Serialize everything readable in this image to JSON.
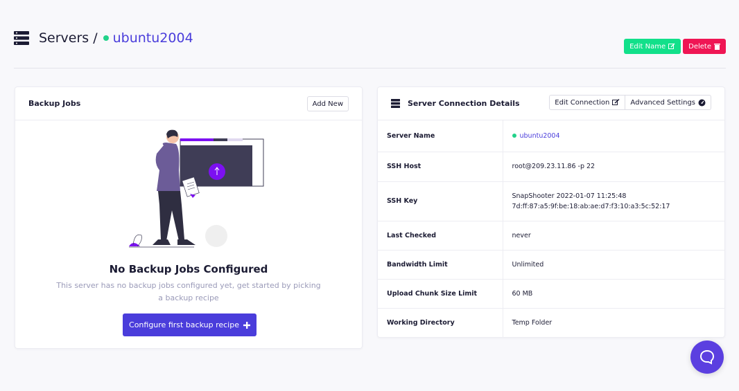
{
  "header": {
    "title": "Servers",
    "separator": "/",
    "server_name": "ubuntu2004",
    "status_color": "#22d28a"
  },
  "actions": {
    "edit_name": "Edit Name",
    "delete": "Delete"
  },
  "backup_jobs": {
    "title": "Backup Jobs",
    "add_new": "Add New",
    "empty_title": "No Backup Jobs Configured",
    "empty_desc": "This server has no backup jobs configured yet, get started by picking a backup recipe",
    "cta": "Configure first backup recipe"
  },
  "connection": {
    "title": "Server Connection Details",
    "edit_connection": "Edit Connection",
    "advanced_settings": "Advanced Settings",
    "rows": [
      {
        "label": "Server Name",
        "value": "ubuntu2004"
      },
      {
        "label": "SSH Host",
        "value": "root@209.23.11.86 -p 22"
      },
      {
        "label": "SSH Key",
        "value": "SnapShooter 2022-01-07 11:25:48",
        "value2": "7d:ff:87:a5:9f:be:18:ab:ae:d7:f3:10:a3:5c:52:17"
      },
      {
        "label": "Last Checked",
        "value": "never"
      },
      {
        "label": "Bandwidth Limit",
        "value": "Unlimited"
      },
      {
        "label": "Upload Chunk Size Limit",
        "value": "60 MB"
      },
      {
        "label": "Working Directory",
        "value": "Temp Folder"
      }
    ]
  },
  "colors": {
    "accent": "#4a3ddb",
    "edit": "#12e08a",
    "delete": "#ef1654",
    "chat": "#5b3fe0"
  },
  "icons": [
    "server-icon",
    "edit-icon",
    "trash-icon",
    "plus-icon",
    "gauge-icon",
    "chat-icon"
  ]
}
